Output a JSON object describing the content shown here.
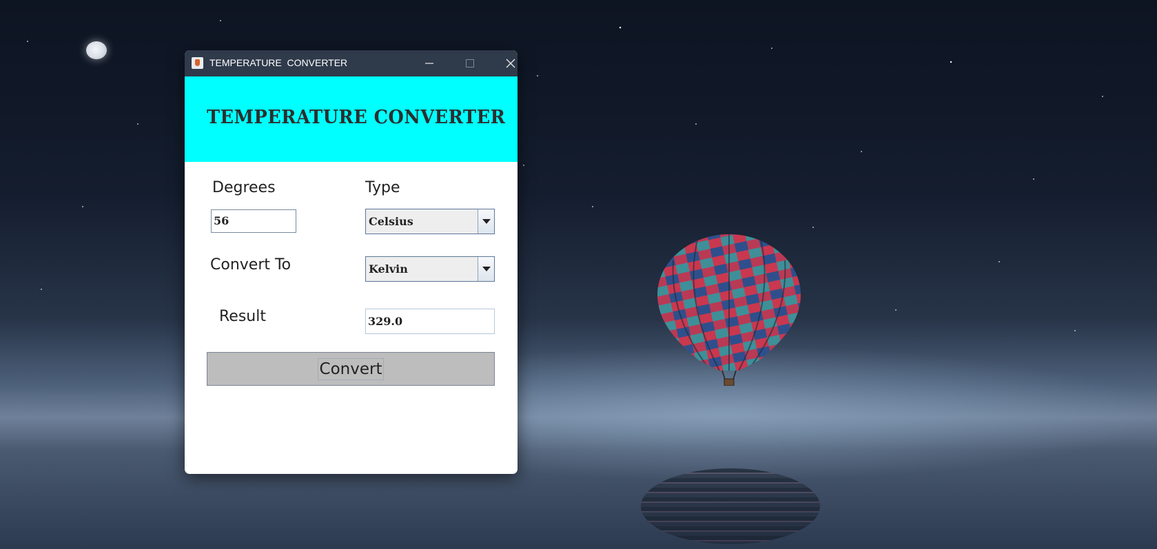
{
  "window": {
    "title": "TEMPERATURE  CONVERTER",
    "minimize_icon": "minimize-icon",
    "maximize_icon": "maximize-icon",
    "close_icon": "close-icon"
  },
  "banner": {
    "title": "TEMPERATURE CONVERTER",
    "color": "#00ffff"
  },
  "form": {
    "degrees_label": "Degrees",
    "degrees_value": "56",
    "type_label": "Type",
    "type_selected": "Celsius",
    "convert_to_label": "Convert To",
    "convert_to_selected": "Kelvin",
    "result_label": "Result",
    "result_value": "329.0",
    "convert_button": "Convert"
  }
}
